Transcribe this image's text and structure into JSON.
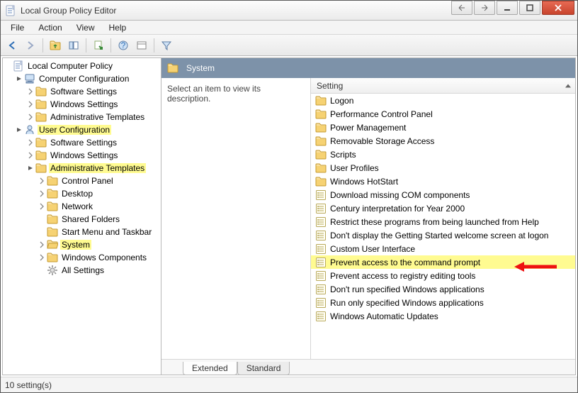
{
  "title": "Local Group Policy Editor",
  "menubar": [
    "File",
    "Action",
    "View",
    "Help"
  ],
  "statusbar": "10 setting(s)",
  "desc_hint": "Select an item to view its description.",
  "right_header": "System",
  "list_header": "Setting",
  "tabs": {
    "extended": "Extended",
    "standard": "Standard"
  },
  "tree_root": "Local Computer Policy",
  "tree_cc": "Computer Configuration",
  "tree_cc_children": [
    "Software Settings",
    "Windows Settings",
    "Administrative Templates"
  ],
  "tree_uc": "User Configuration",
  "tree_uc_children": [
    "Software Settings",
    "Windows Settings"
  ],
  "tree_admin": "Administrative Templates",
  "tree_admin_children": [
    "Control Panel",
    "Desktop",
    "Network",
    "Shared Folders",
    "Start Menu and Taskbar",
    "System",
    "Windows Components",
    "All Settings"
  ],
  "list_items": [
    {
      "type": "folder",
      "label": "Logon"
    },
    {
      "type": "folder",
      "label": "Performance Control Panel"
    },
    {
      "type": "folder",
      "label": "Power Management"
    },
    {
      "type": "folder",
      "label": "Removable Storage Access"
    },
    {
      "type": "folder",
      "label": "Scripts"
    },
    {
      "type": "folder",
      "label": "User Profiles"
    },
    {
      "type": "folder",
      "label": "Windows HotStart"
    },
    {
      "type": "setting",
      "label": "Download missing COM components"
    },
    {
      "type": "setting",
      "label": "Century interpretation for Year 2000"
    },
    {
      "type": "setting",
      "label": "Restrict these programs from being launched from Help"
    },
    {
      "type": "setting",
      "label": "Don't display the Getting Started welcome screen at logon"
    },
    {
      "type": "setting",
      "label": "Custom User Interface"
    },
    {
      "type": "setting",
      "label": "Prevent access to the command prompt",
      "highlight": true
    },
    {
      "type": "setting",
      "label": "Prevent access to registry editing tools"
    },
    {
      "type": "setting",
      "label": "Don't run specified Windows applications"
    },
    {
      "type": "setting",
      "label": "Run only specified Windows applications"
    },
    {
      "type": "setting",
      "label": "Windows Automatic Updates"
    }
  ]
}
